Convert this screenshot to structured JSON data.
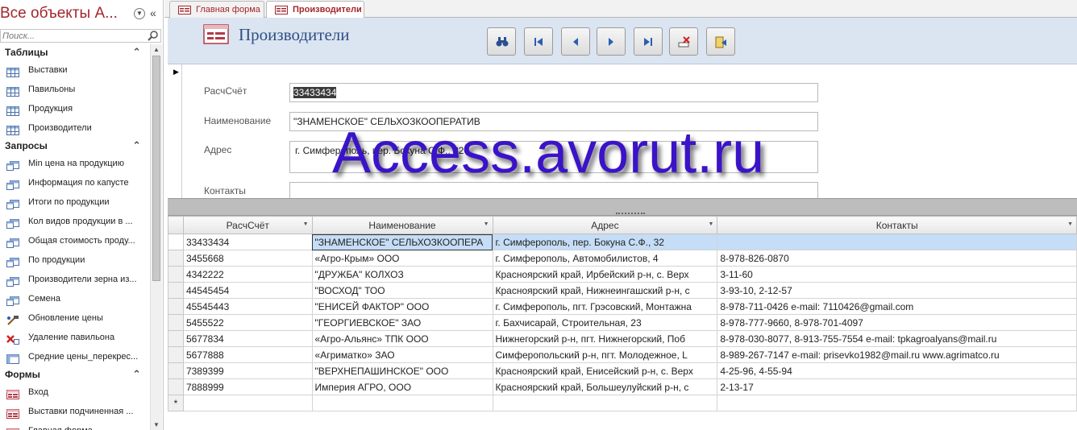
{
  "nav": {
    "title": "Все объекты А...",
    "search_placeholder": "Поиск...",
    "groups": [
      {
        "label": "Таблицы",
        "items": [
          {
            "label": "Выставки",
            "icon": "table-icon"
          },
          {
            "label": "Павильоны",
            "icon": "table-icon"
          },
          {
            "label": "Продукция",
            "icon": "table-icon"
          },
          {
            "label": "Производители",
            "icon": "table-icon"
          }
        ]
      },
      {
        "label": "Запросы",
        "items": [
          {
            "label": "Min цена на продукцию",
            "icon": "query-icon"
          },
          {
            "label": "Информация по капусте",
            "icon": "query-icon"
          },
          {
            "label": "Итоги по продукции",
            "icon": "query-icon"
          },
          {
            "label": "Кол видов продукции в ...",
            "icon": "query-icon"
          },
          {
            "label": "Общая стоимость проду...",
            "icon": "query-icon"
          },
          {
            "label": "По продукции",
            "icon": "query-icon"
          },
          {
            "label": "Производители зерна из...",
            "icon": "query-icon"
          },
          {
            "label": "Семена",
            "icon": "query-icon"
          },
          {
            "label": "Обновление цены",
            "icon": "update-query-icon"
          },
          {
            "label": "Удаление павильона",
            "icon": "delete-query-icon"
          },
          {
            "label": "Средние цены_перекрес...",
            "icon": "crosstab-query-icon"
          }
        ]
      },
      {
        "label": "Формы",
        "items": [
          {
            "label": "Вход",
            "icon": "form-icon"
          },
          {
            "label": "Выставки подчиненная ...",
            "icon": "form-icon"
          },
          {
            "label": "Главная форма",
            "icon": "form-icon"
          }
        ]
      }
    ]
  },
  "tabs": [
    {
      "label": "Главная форма",
      "active": false
    },
    {
      "label": "Производители",
      "active": true
    }
  ],
  "form": {
    "title": "Производители",
    "fields": {
      "account": {
        "label": "РасчСчёт",
        "value": "33433434"
      },
      "name": {
        "label": "Наименование",
        "value": "\"ЗНАМЕНСКОЕ\" СЕЛЬХОЗКООПЕРАТИВ"
      },
      "address": {
        "label": "Адрес",
        "value": "г. Симферополь, пер. Бокуна С.Ф., 32"
      },
      "contacts": {
        "label": "Контакты",
        "value": ""
      }
    }
  },
  "toolbar": [
    "find-icon",
    "first-record-icon",
    "previous-record-icon",
    "next-record-icon",
    "last-record-icon",
    "delete-record-icon",
    "close-form-icon"
  ],
  "watermark": "Access.avorut.ru",
  "grid": {
    "columns": [
      "РасчСчёт",
      "Наименование",
      "Адрес",
      "Контакты"
    ],
    "rows": [
      [
        "33433434",
        "\"ЗНАМЕНСКОЕ\" СЕЛЬХОЗКООПЕРА",
        "г. Симферополь, пер. Бокуна С.Ф., 32",
        ""
      ],
      [
        "3455668",
        "«Агро-Крым» ООО",
        "г. Симферополь, Автомобилистов, 4",
        "8-978-826-0870"
      ],
      [
        "4342222",
        "\"ДРУЖБА\" КОЛХОЗ",
        "Красноярский край, Ирбейский р-н, с. Верх",
        "3-11-60"
      ],
      [
        "44545454",
        "\"ВОСХОД\" ТОО",
        "Красноярский край, Нижнеингашский р-н, с",
        "3-93-10, 2-12-57"
      ],
      [
        "45545443",
        "\"ЕНИСЕЙ ФАКТОР\" ООО",
        "г. Симферополь, пгт. Грэсовский, Монтажна",
        "8-978-711-0426 e-mail: 7110426@gmail.com"
      ],
      [
        "5455522",
        "\"ГЕОРГИЕВСКОЕ\" ЗАО",
        "г. Бахчисарай, Строительная, 23",
        "8-978-777-9660, 8-978-701-4097"
      ],
      [
        "5677834",
        "«Агро-Альянс» ТПК ООО",
        "Нижнегорский р-н, пгт. Нижнегорский, Поб",
        "8-978-030-8077, 8-913-755-7554 e-mail: tpkagroalyans@mail.ru"
      ],
      [
        "5677888",
        "«Агриматко» ЗАО",
        "Симферопольский р-н, пгт. Молодежное, L",
        "8-989-267-7147 e-mail: prisevko1982@mail.ru www.agrimatco.ru"
      ],
      [
        "7389399",
        "\"ВЕРХНЕПАШИНСКОЕ\" ООО",
        "Красноярский край, Енисейский р-н, с. Верх",
        "4-25-96, 4-55-94"
      ],
      [
        "7888999",
        "Империя АГРО, ООО",
        "Красноярский край, Большеулуйский р-н, с",
        " 2-13-17"
      ]
    ],
    "new_row_marker": "*"
  }
}
